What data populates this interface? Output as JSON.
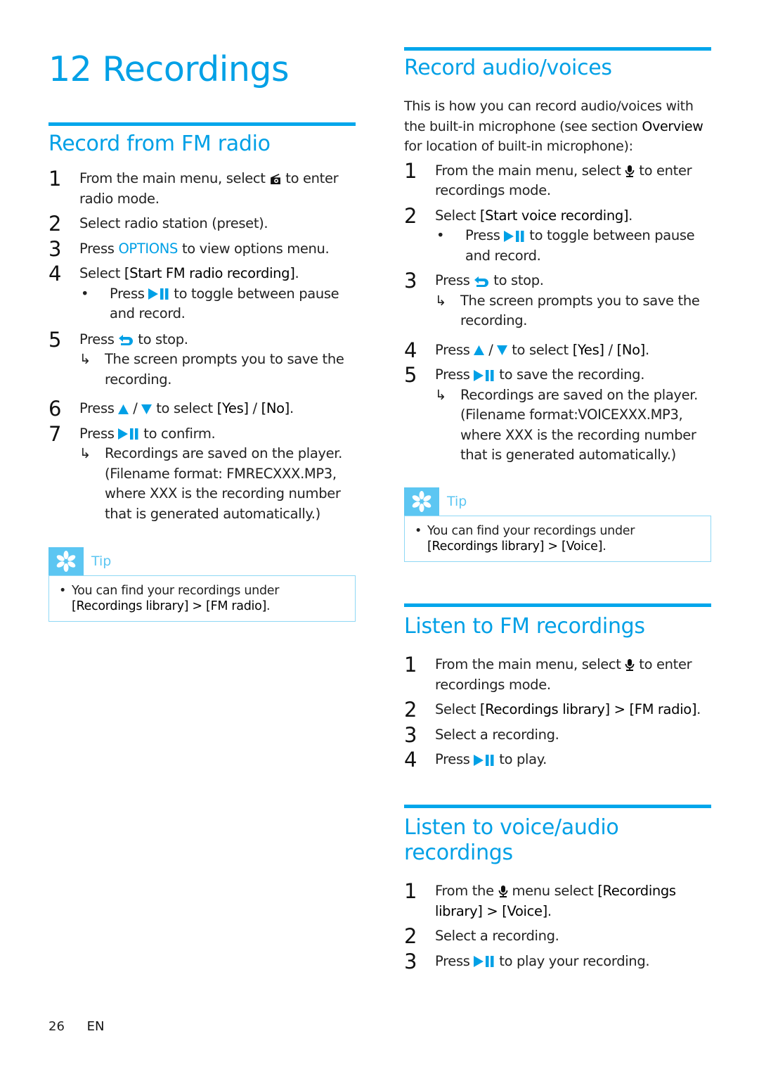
{
  "chapter": {
    "number": "12",
    "title": "Recordings"
  },
  "colors": {
    "accent": "#00a0e6",
    "rule": "#00a6eb",
    "tip_badge": "#5cc6f2",
    "tip_border": "#8fd8f5"
  },
  "icons": {
    "radio": "radio-icon",
    "mic": "microphone-icon",
    "play_pause": "play-pause-icon",
    "back": "back-icon",
    "up": "up-arrow-icon",
    "down": "down-arrow-icon",
    "result_arrow": "result-arrow-icon",
    "tip": "tip-asterisk-icon"
  },
  "record_fm": {
    "title": "Record from FM radio",
    "steps": [
      {
        "num": "1",
        "pre": "From the main menu, select",
        "post": "to enter radio mode."
      },
      {
        "num": "2",
        "text": "Select radio station (preset)."
      },
      {
        "num": "3",
        "pre": "Press",
        "keyword": "OPTIONS",
        "post": "to view options menu."
      },
      {
        "num": "4",
        "pre": "Select",
        "keyword": "[Start FM radio recording]",
        "post": ".",
        "bullet": {
          "pre": "Press",
          "post": "to toggle between pause and record."
        }
      },
      {
        "num": "5",
        "pre": "Press",
        "post": "to stop.",
        "result": "The screen prompts you to save the recording."
      },
      {
        "num": "6",
        "pre": "Press",
        "sep": "/",
        "mid": "to select",
        "yes": "[Yes]",
        "slash": "/",
        "no": "[No]",
        "end": "."
      },
      {
        "num": "7",
        "pre": "Press",
        "post": "to confirm.",
        "result": "Recordings are saved on the player. (Filename format: FMRECXXX.MP3, where XXX is the recording number that is generated automatically.)"
      }
    ],
    "tip": {
      "label": "Tip",
      "line1": "You can find your recordings under",
      "line2": "[Recordings library] > [FM radio]",
      "end": "."
    }
  },
  "record_voice": {
    "title": "Record audio/voices",
    "intro_pre": "This is how you can record audio/voices with the built-in microphone (see section",
    "intro_kw": "Overview",
    "intro_post": "for location of built-in microphone):",
    "steps": [
      {
        "num": "1",
        "pre": "From the main menu, select",
        "post": "to enter recordings mode."
      },
      {
        "num": "2",
        "pre": "Select",
        "keyword": "[Start voice recording]",
        "post": ".",
        "bullet": {
          "pre": "Press",
          "post": "to toggle between pause and record."
        }
      },
      {
        "num": "3",
        "pre": "Press",
        "post": "to stop.",
        "result": "The screen prompts you to save the recording."
      },
      {
        "num": "4",
        "pre": "Press",
        "sep": "/",
        "mid": "to select",
        "yes": "[Yes]",
        "slash": "/",
        "no": "[No]",
        "end": "."
      },
      {
        "num": "5",
        "pre": "Press",
        "post": "to save the recording.",
        "result": "Recordings are saved on the player. (Filename format:VOICEXXX.MP3, where XXX is the recording number that is generated automatically.)"
      }
    ],
    "tip": {
      "label": "Tip",
      "line1": "You can find your recordings under",
      "line2": "[Recordings library] > [Voice]",
      "end": "."
    }
  },
  "listen_fm": {
    "title": "Listen to FM recordings",
    "steps": [
      {
        "num": "1",
        "pre": "From the main menu, select",
        "post": "to enter recordings mode."
      },
      {
        "num": "2",
        "pre": "Select",
        "keyword": "[Recordings library] > [FM radio]",
        "post": "."
      },
      {
        "num": "3",
        "text": "Select a recording."
      },
      {
        "num": "4",
        "pre": "Press",
        "post": "to play."
      }
    ]
  },
  "listen_voice": {
    "title": "Listen to voice/audio recordings",
    "steps": [
      {
        "num": "1",
        "pre": "From the",
        "mid": "menu select",
        "keyword": "[Recordings library] > [Voice]",
        "post": "."
      },
      {
        "num": "2",
        "text": "Select a recording."
      },
      {
        "num": "3",
        "pre": "Press",
        "post": "to play your recording."
      }
    ]
  },
  "footer": {
    "page": "26",
    "lang": "EN"
  }
}
